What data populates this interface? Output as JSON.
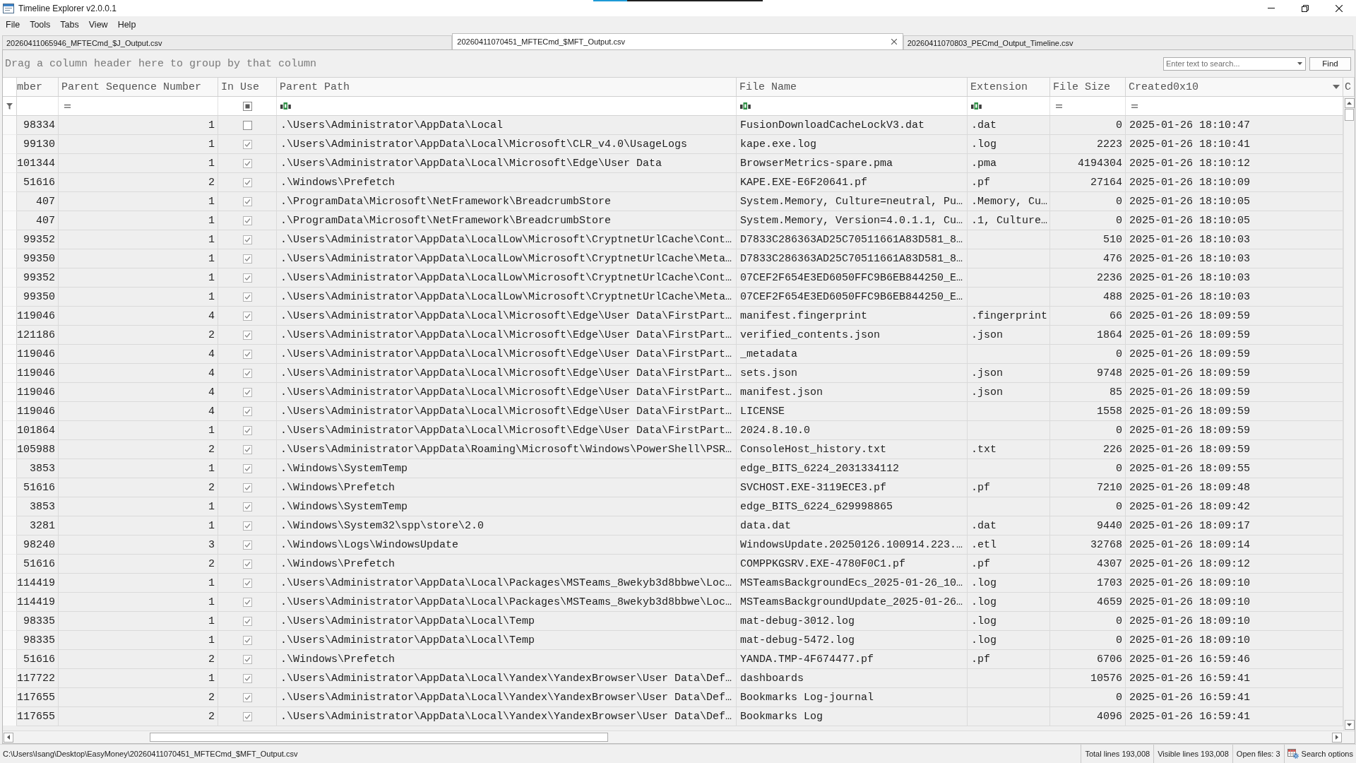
{
  "window": {
    "title": "Timeline Explorer v2.0.0.1"
  },
  "menu": [
    "File",
    "Tools",
    "Tabs",
    "View",
    "Help"
  ],
  "tabs": [
    {
      "label": "20260411065946_MFTECmd_$J_Output.csv",
      "selected": false
    },
    {
      "label": "20260411070451_MFTECmd_$MFT_Output.csv",
      "selected": true
    },
    {
      "label": "20260411070803_PECmd_Output_Timeline.csv",
      "selected": false
    }
  ],
  "group_panel": {
    "hint": "Drag a column header here to group by that column"
  },
  "search": {
    "placeholder": "Enter text to search...",
    "button": "Find"
  },
  "table": {
    "columns": [
      {
        "label": "mber",
        "hovered": false
      },
      {
        "label": "Parent Sequence Number",
        "hovered": false
      },
      {
        "label": "In Use",
        "hovered": false
      },
      {
        "label": "Parent Path",
        "hovered": false
      },
      {
        "label": "File Name",
        "hovered": false
      },
      {
        "label": "Extension",
        "hovered": false
      },
      {
        "label": "File Size",
        "hovered": false
      },
      {
        "label": "Created0x10",
        "hovered": true
      },
      {
        "label": "C",
        "hovered": false
      }
    ],
    "filter_row": [
      {
        "kind": "none"
      },
      {
        "kind": "equals"
      },
      {
        "kind": "checkbox",
        "indeterminate": true
      },
      {
        "kind": "text"
      },
      {
        "kind": "text"
      },
      {
        "kind": "text"
      },
      {
        "kind": "equals"
      },
      {
        "kind": "equals"
      }
    ],
    "rows": [
      {
        "column_1": "98334",
        "parent_sequence_number": "1",
        "in_use": false,
        "parent_path": ".\\Users\\Administrator\\AppData\\Local",
        "file_name": "FusionDownloadCacheLockV3.dat",
        "extension": ".dat",
        "file_size": "0",
        "created0x10": "2025-01-26 18:10:47"
      },
      {
        "column_1": "99130",
        "parent_sequence_number": "1",
        "in_use": true,
        "parent_path": ".\\Users\\Administrator\\AppData\\Local\\Microsoft\\CLR_v4.0\\UsageLogs",
        "file_name": "kape.exe.log",
        "extension": ".log",
        "file_size": "2223",
        "created0x10": "2025-01-26 18:10:41"
      },
      {
        "column_1": "101344",
        "parent_sequence_number": "1",
        "in_use": true,
        "parent_path": ".\\Users\\Administrator\\AppData\\Local\\Microsoft\\Edge\\User Data",
        "file_name": "BrowserMetrics-spare.pma",
        "extension": ".pma",
        "file_size": "4194304",
        "created0x10": "2025-01-26 18:10:12"
      },
      {
        "column_1": "51616",
        "parent_sequence_number": "2",
        "in_use": true,
        "parent_path": ".\\Windows\\Prefetch",
        "file_name": "KAPE.EXE-E6F20641.pf",
        "extension": ".pf",
        "file_size": "27164",
        "created0x10": "2025-01-26 18:10:09"
      },
      {
        "column_1": "407",
        "parent_sequence_number": "1",
        "in_use": true,
        "parent_path": ".\\ProgramData\\Microsoft\\NetFramework\\BreadcrumbStore",
        "file_name": "System.Memory, Culture=neutral, Pu…",
        "extension": ".Memory, Cu…",
        "file_size": "0",
        "created0x10": "2025-01-26 18:10:05"
      },
      {
        "column_1": "407",
        "parent_sequence_number": "1",
        "in_use": true,
        "parent_path": ".\\ProgramData\\Microsoft\\NetFramework\\BreadcrumbStore",
        "file_name": "System.Memory, Version=4.0.1.1, Cu…",
        "extension": ".1, Culture…",
        "file_size": "0",
        "created0x10": "2025-01-26 18:10:05"
      },
      {
        "column_1": "99352",
        "parent_sequence_number": "1",
        "in_use": true,
        "parent_path": ".\\Users\\Administrator\\AppData\\LocalLow\\Microsoft\\CryptnetUrlCache\\Cont…",
        "file_name": "D7833C286363AD25C70511661A83D581_8…",
        "file_size": "510",
        "created0x10": "2025-01-26 18:10:03"
      },
      {
        "column_1": "99350",
        "parent_sequence_number": "1",
        "in_use": true,
        "parent_path": ".\\Users\\Administrator\\AppData\\LocalLow\\Microsoft\\CryptnetUrlCache\\Meta…",
        "file_name": "D7833C286363AD25C70511661A83D581_8…",
        "file_size": "476",
        "created0x10": "2025-01-26 18:10:03"
      },
      {
        "column_1": "99352",
        "parent_sequence_number": "1",
        "in_use": true,
        "parent_path": ".\\Users\\Administrator\\AppData\\LocalLow\\Microsoft\\CryptnetUrlCache\\Cont…",
        "file_name": "07CEF2F654E3ED6050FFC9B6EB844250_E…",
        "file_size": "2236",
        "created0x10": "2025-01-26 18:10:03"
      },
      {
        "column_1": "99350",
        "parent_sequence_number": "1",
        "in_use": true,
        "parent_path": ".\\Users\\Administrator\\AppData\\LocalLow\\Microsoft\\CryptnetUrlCache\\Meta…",
        "file_name": "07CEF2F654E3ED6050FFC9B6EB844250_E…",
        "file_size": "488",
        "created0x10": "2025-01-26 18:10:03"
      },
      {
        "column_1": "119046",
        "parent_sequence_number": "4",
        "in_use": true,
        "parent_path": ".\\Users\\Administrator\\AppData\\Local\\Microsoft\\Edge\\User Data\\FirstPart…",
        "file_name": "manifest.fingerprint",
        "extension": ".fingerprint",
        "file_size": "66",
        "created0x10": "2025-01-26 18:09:59"
      },
      {
        "column_1": "121186",
        "parent_sequence_number": "2",
        "in_use": true,
        "parent_path": ".\\Users\\Administrator\\AppData\\Local\\Microsoft\\Edge\\User Data\\FirstPart…",
        "file_name": "verified_contents.json",
        "extension": ".json",
        "file_size": "1864",
        "created0x10": "2025-01-26 18:09:59"
      },
      {
        "column_1": "119046",
        "parent_sequence_number": "4",
        "in_use": true,
        "parent_path": ".\\Users\\Administrator\\AppData\\Local\\Microsoft\\Edge\\User Data\\FirstPart…",
        "file_name": "_metadata",
        "file_size": "0",
        "created0x10": "2025-01-26 18:09:59"
      },
      {
        "column_1": "119046",
        "parent_sequence_number": "4",
        "in_use": true,
        "parent_path": ".\\Users\\Administrator\\AppData\\Local\\Microsoft\\Edge\\User Data\\FirstPart…",
        "file_name": "sets.json",
        "extension": ".json",
        "file_size": "9748",
        "created0x10": "2025-01-26 18:09:59"
      },
      {
        "column_1": "119046",
        "parent_sequence_number": "4",
        "in_use": true,
        "parent_path": ".\\Users\\Administrator\\AppData\\Local\\Microsoft\\Edge\\User Data\\FirstPart…",
        "file_name": "manifest.json",
        "extension": ".json",
        "file_size": "85",
        "created0x10": "2025-01-26 18:09:59"
      },
      {
        "column_1": "119046",
        "parent_sequence_number": "4",
        "in_use": true,
        "parent_path": ".\\Users\\Administrator\\AppData\\Local\\Microsoft\\Edge\\User Data\\FirstPart…",
        "file_name": "LICENSE",
        "file_size": "1558",
        "created0x10": "2025-01-26 18:09:59"
      },
      {
        "column_1": "101864",
        "parent_sequence_number": "1",
        "in_use": true,
        "parent_path": ".\\Users\\Administrator\\AppData\\Local\\Microsoft\\Edge\\User Data\\FirstPart…",
        "file_name": "2024.8.10.0",
        "file_size": "0",
        "created0x10": "2025-01-26 18:09:59"
      },
      {
        "column_1": "105988",
        "parent_sequence_number": "2",
        "in_use": true,
        "parent_path": ".\\Users\\Administrator\\AppData\\Roaming\\Microsoft\\Windows\\PowerShell\\PSR…",
        "file_name": "ConsoleHost_history.txt",
        "extension": ".txt",
        "file_size": "226",
        "created0x10": "2025-01-26 18:09:59"
      },
      {
        "column_1": "3853",
        "parent_sequence_number": "1",
        "in_use": true,
        "parent_path": ".\\Windows\\SystemTemp",
        "file_name": "edge_BITS_6224_2031334112",
        "file_size": "0",
        "created0x10": "2025-01-26 18:09:55"
      },
      {
        "column_1": "51616",
        "parent_sequence_number": "2",
        "in_use": true,
        "parent_path": ".\\Windows\\Prefetch",
        "file_name": "SVCHOST.EXE-3119ECE3.pf",
        "extension": ".pf",
        "file_size": "7210",
        "created0x10": "2025-01-26 18:09:48"
      },
      {
        "column_1": "3853",
        "parent_sequence_number": "1",
        "in_use": true,
        "parent_path": ".\\Windows\\SystemTemp",
        "file_name": "edge_BITS_6224_629998865",
        "file_size": "0",
        "created0x10": "2025-01-26 18:09:42"
      },
      {
        "column_1": "3281",
        "parent_sequence_number": "1",
        "in_use": true,
        "parent_path": ".\\Windows\\System32\\spp\\store\\2.0",
        "file_name": "data.dat",
        "extension": ".dat",
        "file_size": "9440",
        "created0x10": "2025-01-26 18:09:17"
      },
      {
        "column_1": "98240",
        "parent_sequence_number": "3",
        "in_use": true,
        "parent_path": ".\\Windows\\Logs\\WindowsUpdate",
        "file_name": "WindowsUpdate.20250126.100914.223.…",
        "extension": ".etl",
        "file_size": "32768",
        "created0x10": "2025-01-26 18:09:14"
      },
      {
        "column_1": "51616",
        "parent_sequence_number": "2",
        "in_use": true,
        "parent_path": ".\\Windows\\Prefetch",
        "file_name": "COMPPKGSRV.EXE-4780F0C1.pf",
        "extension": ".pf",
        "file_size": "4307",
        "created0x10": "2025-01-26 18:09:12"
      },
      {
        "column_1": "114419",
        "parent_sequence_number": "1",
        "in_use": true,
        "parent_path": ".\\Users\\Administrator\\AppData\\Local\\Packages\\MSTeams_8wekyb3d8bbwe\\Loc…",
        "file_name": "MSTeamsBackgroundEcs_2025-01-26_10…",
        "extension": ".log",
        "file_size": "1703",
        "created0x10": "2025-01-26 18:09:10"
      },
      {
        "column_1": "114419",
        "parent_sequence_number": "1",
        "in_use": true,
        "parent_path": ".\\Users\\Administrator\\AppData\\Local\\Packages\\MSTeams_8wekyb3d8bbwe\\Loc…",
        "file_name": "MSTeamsBackgroundUpdate_2025-01-26…",
        "extension": ".log",
        "file_size": "4659",
        "created0x10": "2025-01-26 18:09:10"
      },
      {
        "column_1": "98335",
        "parent_sequence_number": "1",
        "in_use": true,
        "parent_path": ".\\Users\\Administrator\\AppData\\Local\\Temp",
        "file_name": "mat-debug-3012.log",
        "extension": ".log",
        "file_size": "0",
        "created0x10": "2025-01-26 18:09:10"
      },
      {
        "column_1": "98335",
        "parent_sequence_number": "1",
        "in_use": true,
        "parent_path": ".\\Users\\Administrator\\AppData\\Local\\Temp",
        "file_name": "mat-debug-5472.log",
        "extension": ".log",
        "file_size": "0",
        "created0x10": "2025-01-26 18:09:10"
      },
      {
        "column_1": "51616",
        "parent_sequence_number": "2",
        "in_use": true,
        "parent_path": ".\\Windows\\Prefetch",
        "file_name": "YANDA.TMP-4F674477.pf",
        "extension": ".pf",
        "file_size": "6706",
        "created0x10": "2025-01-26 16:59:46"
      },
      {
        "column_1": "117722",
        "parent_sequence_number": "1",
        "in_use": true,
        "parent_path": ".\\Users\\Administrator\\AppData\\Local\\Yandex\\YandexBrowser\\User Data\\Def…",
        "file_name": "dashboards",
        "file_size": "10576",
        "created0x10": "2025-01-26 16:59:41"
      },
      {
        "column_1": "117655",
        "parent_sequence_number": "2",
        "in_use": true,
        "parent_path": ".\\Users\\Administrator\\AppData\\Local\\Yandex\\YandexBrowser\\User Data\\Def…",
        "file_name": "Bookmarks Log-journal",
        "file_size": "0",
        "created0x10": "2025-01-26 16:59:41"
      },
      {
        "column_1": "117655",
        "parent_sequence_number": "2",
        "in_use": true,
        "parent_path": ".\\Users\\Administrator\\AppData\\Local\\Yandex\\YandexBrowser\\User Data\\Def…",
        "file_name": "Bookmarks Log",
        "file_size": "4096",
        "created0x10": "2025-01-26 16:59:41"
      }
    ]
  },
  "status_bar": {
    "file_path": "C:\\Users\\Isang\\Desktop\\EasyMoney\\20260411070451_MFTECmd_$MFT_Output.csv",
    "total_lines": "Total lines 193,008",
    "visible_lines": "Visible lines 193,008",
    "open_files": "Open files: 3",
    "search_options": "Search options"
  }
}
